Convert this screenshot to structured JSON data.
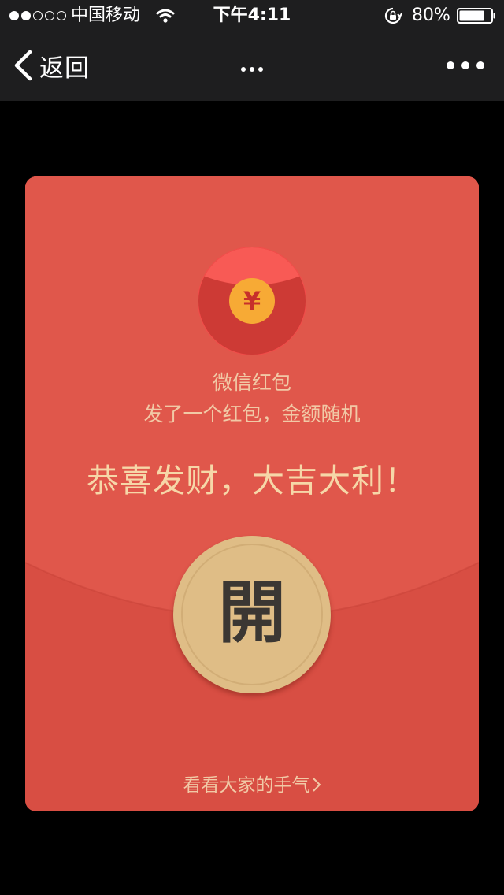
{
  "status_bar": {
    "signal_dots_filled": 2,
    "signal_dots_total": 5,
    "carrier": "中国移动",
    "wifi_icon": "wifi-icon",
    "time": "下午4:11",
    "orientation_lock_icon": "rotation-lock-icon",
    "battery_percent_label": "80%",
    "battery_level": 0.8
  },
  "nav": {
    "back_label": "返回",
    "back_icon": "chevron-left-icon",
    "title_icon": "loading-dots-icon",
    "more_icon": "more-icon"
  },
  "envelope": {
    "badge_icon": "yuan-coin-icon",
    "badge_symbol": "¥",
    "sender": "微信红包",
    "subtitle": "发了一个红包，金额随机",
    "greeting": "恭喜发财，大吉大利！",
    "open_label": "開",
    "view_luck_label": "看看大家的手气",
    "view_luck_icon": "chevron-right-icon"
  },
  "colors": {
    "status_bg": "#1e1e1f",
    "page_bg": "#000000",
    "envelope_top": "#e0574b",
    "envelope_bottom": "#d84e43",
    "badge_red": "#f0524b",
    "badge_dark": "#cc3b35",
    "coin": "#f5a933",
    "text_gold": "#f1c9a6",
    "button_gold": "#dfbd86",
    "button_text": "#3b3733"
  }
}
